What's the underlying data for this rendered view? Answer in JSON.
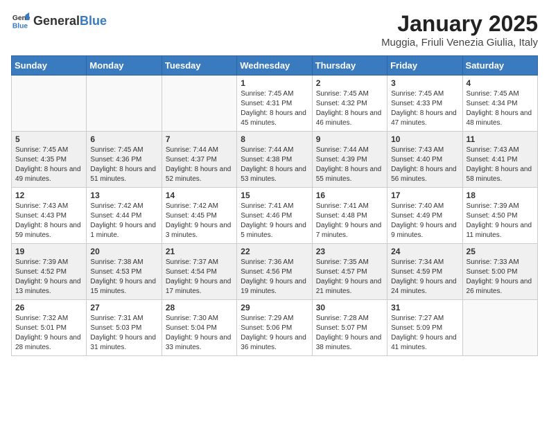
{
  "logo": {
    "general": "General",
    "blue": "Blue"
  },
  "title": "January 2025",
  "subtitle": "Muggia, Friuli Venezia Giulia, Italy",
  "weekdays": [
    "Sunday",
    "Monday",
    "Tuesday",
    "Wednesday",
    "Thursday",
    "Friday",
    "Saturday"
  ],
  "weeks": [
    [
      {
        "day": "",
        "info": ""
      },
      {
        "day": "",
        "info": ""
      },
      {
        "day": "",
        "info": ""
      },
      {
        "day": "1",
        "info": "Sunrise: 7:45 AM\nSunset: 4:31 PM\nDaylight: 8 hours and 45 minutes."
      },
      {
        "day": "2",
        "info": "Sunrise: 7:45 AM\nSunset: 4:32 PM\nDaylight: 8 hours and 46 minutes."
      },
      {
        "day": "3",
        "info": "Sunrise: 7:45 AM\nSunset: 4:33 PM\nDaylight: 8 hours and 47 minutes."
      },
      {
        "day": "4",
        "info": "Sunrise: 7:45 AM\nSunset: 4:34 PM\nDaylight: 8 hours and 48 minutes."
      }
    ],
    [
      {
        "day": "5",
        "info": "Sunrise: 7:45 AM\nSunset: 4:35 PM\nDaylight: 8 hours and 49 minutes."
      },
      {
        "day": "6",
        "info": "Sunrise: 7:45 AM\nSunset: 4:36 PM\nDaylight: 8 hours and 51 minutes."
      },
      {
        "day": "7",
        "info": "Sunrise: 7:44 AM\nSunset: 4:37 PM\nDaylight: 8 hours and 52 minutes."
      },
      {
        "day": "8",
        "info": "Sunrise: 7:44 AM\nSunset: 4:38 PM\nDaylight: 8 hours and 53 minutes."
      },
      {
        "day": "9",
        "info": "Sunrise: 7:44 AM\nSunset: 4:39 PM\nDaylight: 8 hours and 55 minutes."
      },
      {
        "day": "10",
        "info": "Sunrise: 7:43 AM\nSunset: 4:40 PM\nDaylight: 8 hours and 56 minutes."
      },
      {
        "day": "11",
        "info": "Sunrise: 7:43 AM\nSunset: 4:41 PM\nDaylight: 8 hours and 58 minutes."
      }
    ],
    [
      {
        "day": "12",
        "info": "Sunrise: 7:43 AM\nSunset: 4:43 PM\nDaylight: 8 hours and 59 minutes."
      },
      {
        "day": "13",
        "info": "Sunrise: 7:42 AM\nSunset: 4:44 PM\nDaylight: 9 hours and 1 minute."
      },
      {
        "day": "14",
        "info": "Sunrise: 7:42 AM\nSunset: 4:45 PM\nDaylight: 9 hours and 3 minutes."
      },
      {
        "day": "15",
        "info": "Sunrise: 7:41 AM\nSunset: 4:46 PM\nDaylight: 9 hours and 5 minutes."
      },
      {
        "day": "16",
        "info": "Sunrise: 7:41 AM\nSunset: 4:48 PM\nDaylight: 9 hours and 7 minutes."
      },
      {
        "day": "17",
        "info": "Sunrise: 7:40 AM\nSunset: 4:49 PM\nDaylight: 9 hours and 9 minutes."
      },
      {
        "day": "18",
        "info": "Sunrise: 7:39 AM\nSunset: 4:50 PM\nDaylight: 9 hours and 11 minutes."
      }
    ],
    [
      {
        "day": "19",
        "info": "Sunrise: 7:39 AM\nSunset: 4:52 PM\nDaylight: 9 hours and 13 minutes."
      },
      {
        "day": "20",
        "info": "Sunrise: 7:38 AM\nSunset: 4:53 PM\nDaylight: 9 hours and 15 minutes."
      },
      {
        "day": "21",
        "info": "Sunrise: 7:37 AM\nSunset: 4:54 PM\nDaylight: 9 hours and 17 minutes."
      },
      {
        "day": "22",
        "info": "Sunrise: 7:36 AM\nSunset: 4:56 PM\nDaylight: 9 hours and 19 minutes."
      },
      {
        "day": "23",
        "info": "Sunrise: 7:35 AM\nSunset: 4:57 PM\nDaylight: 9 hours and 21 minutes."
      },
      {
        "day": "24",
        "info": "Sunrise: 7:34 AM\nSunset: 4:59 PM\nDaylight: 9 hours and 24 minutes."
      },
      {
        "day": "25",
        "info": "Sunrise: 7:33 AM\nSunset: 5:00 PM\nDaylight: 9 hours and 26 minutes."
      }
    ],
    [
      {
        "day": "26",
        "info": "Sunrise: 7:32 AM\nSunset: 5:01 PM\nDaylight: 9 hours and 28 minutes."
      },
      {
        "day": "27",
        "info": "Sunrise: 7:31 AM\nSunset: 5:03 PM\nDaylight: 9 hours and 31 minutes."
      },
      {
        "day": "28",
        "info": "Sunrise: 7:30 AM\nSunset: 5:04 PM\nDaylight: 9 hours and 33 minutes."
      },
      {
        "day": "29",
        "info": "Sunrise: 7:29 AM\nSunset: 5:06 PM\nDaylight: 9 hours and 36 minutes."
      },
      {
        "day": "30",
        "info": "Sunrise: 7:28 AM\nSunset: 5:07 PM\nDaylight: 9 hours and 38 minutes."
      },
      {
        "day": "31",
        "info": "Sunrise: 7:27 AM\nSunset: 5:09 PM\nDaylight: 9 hours and 41 minutes."
      },
      {
        "day": "",
        "info": ""
      }
    ]
  ]
}
